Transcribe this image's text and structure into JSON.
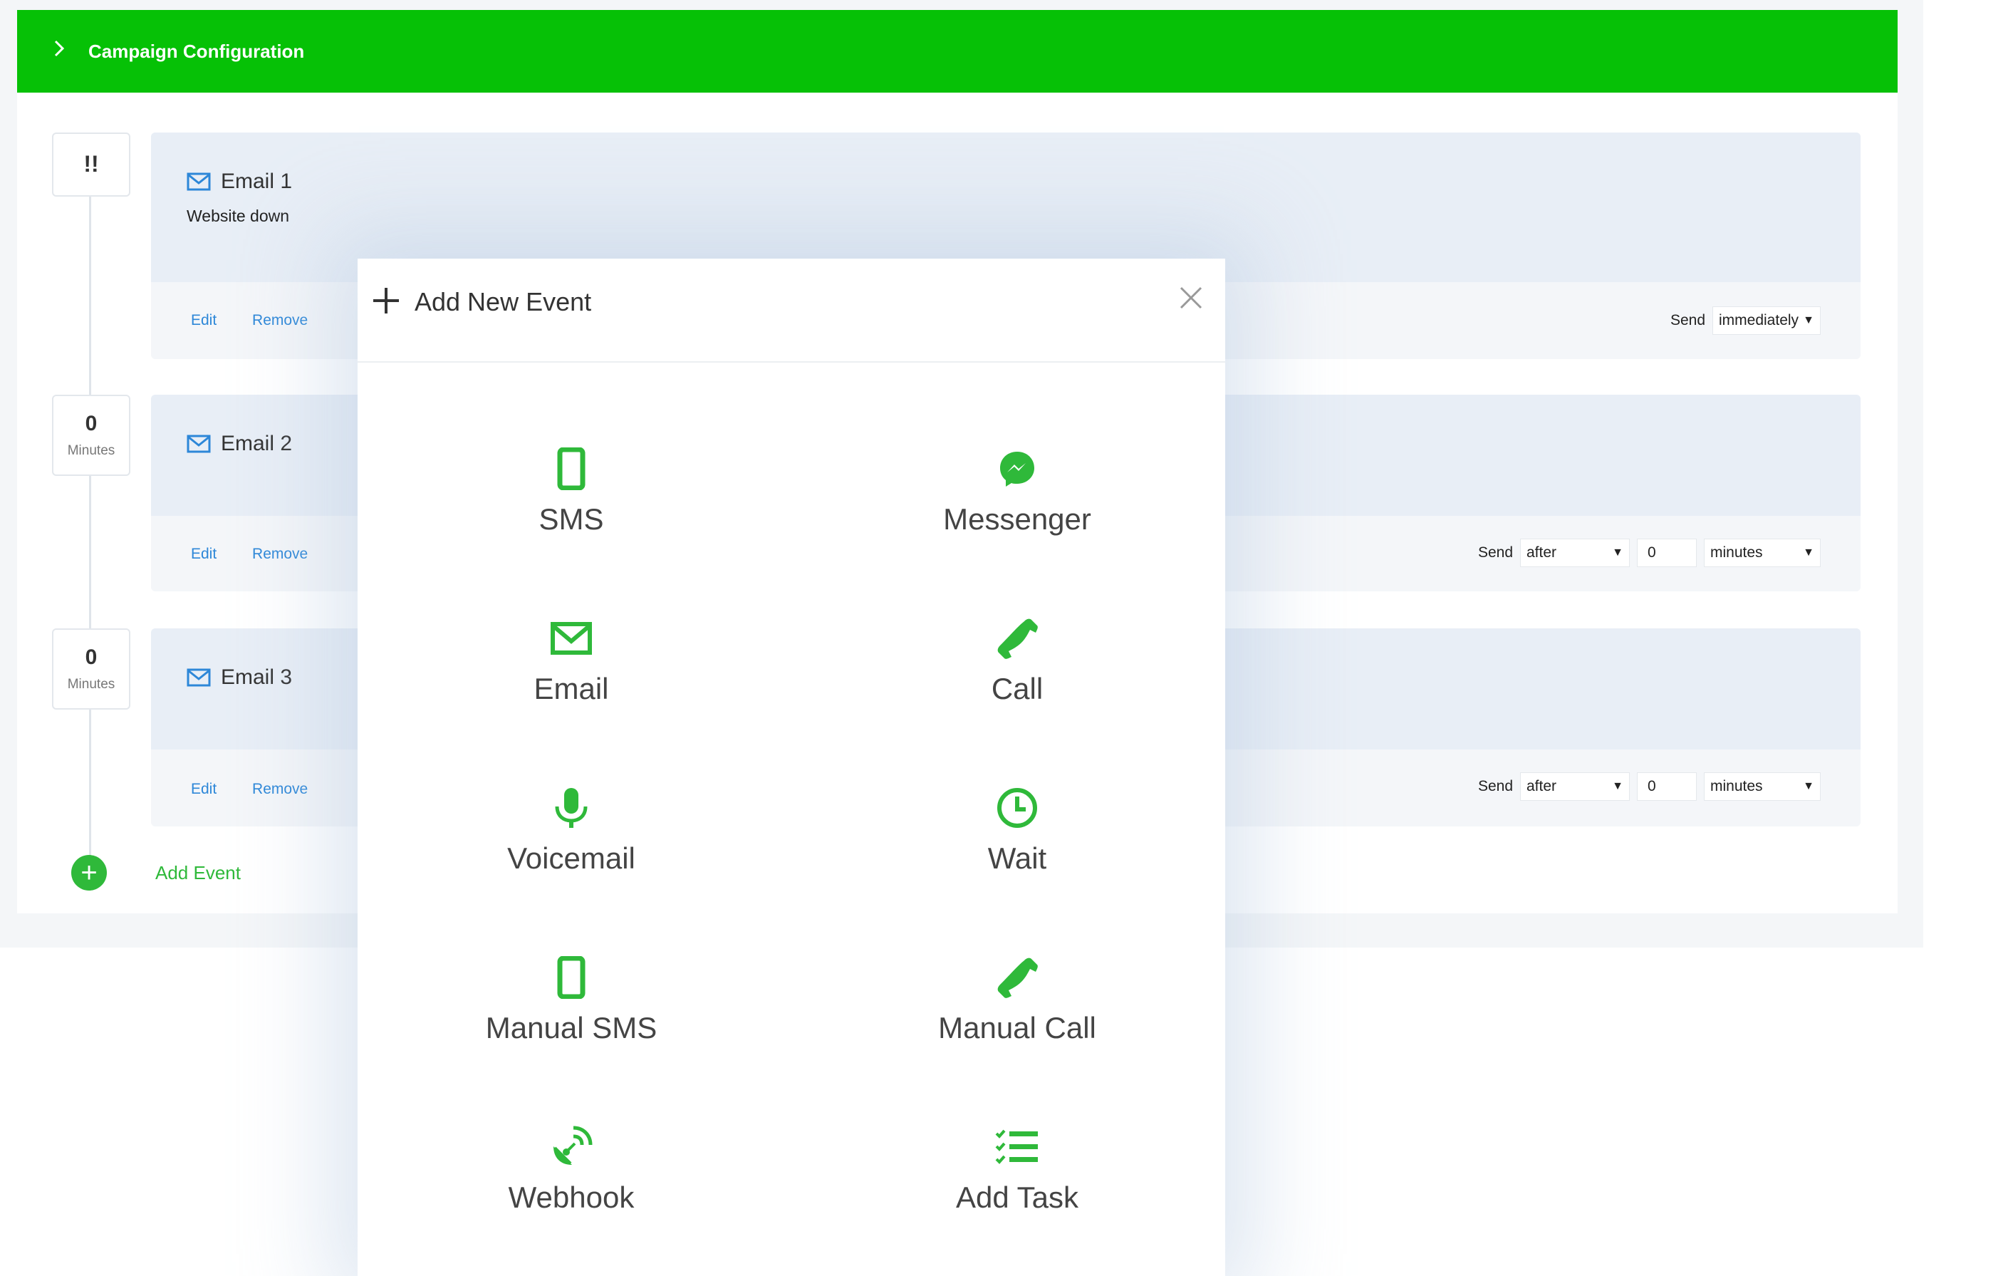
{
  "header": {
    "title": "Campaign Configuration",
    "chevron_icon": "chevron-right-icon"
  },
  "colors": {
    "brand_green": "#06c106",
    "icon_green": "#2fb93a",
    "link_blue": "#2d87d8"
  },
  "timeline": [
    {
      "value": "!!"
    },
    {
      "value": "0",
      "unit": "Minutes"
    },
    {
      "value": "0",
      "unit": "Minutes"
    }
  ],
  "events": [
    {
      "title": "Email 1",
      "subtitle": "Website down",
      "edit": "Edit",
      "remove": "Remove",
      "send_label": "Send",
      "send_when": "immediately"
    },
    {
      "title": "Email 2",
      "edit": "Edit",
      "remove": "Remove",
      "send_label": "Send",
      "send_when": "after",
      "delay": "0",
      "unit": "minutes"
    },
    {
      "title": "Email 3",
      "edit": "Edit",
      "remove": "Remove",
      "send_label": "Send",
      "send_when": "after",
      "delay": "0",
      "unit": "minutes"
    }
  ],
  "add_event": {
    "label": "Add Event"
  },
  "modal": {
    "title": "Add New Event",
    "options": [
      {
        "label": "SMS",
        "icon": "phone-device-icon"
      },
      {
        "label": "Messenger",
        "icon": "messenger-icon"
      },
      {
        "label": "Email",
        "icon": "envelope-icon"
      },
      {
        "label": "Call",
        "icon": "phone-handset-icon"
      },
      {
        "label": "Voicemail",
        "icon": "microphone-icon"
      },
      {
        "label": "Wait",
        "icon": "clock-icon"
      },
      {
        "label": "Manual SMS",
        "icon": "phone-device-icon"
      },
      {
        "label": "Manual Call",
        "icon": "phone-handset-icon"
      },
      {
        "label": "Webhook",
        "icon": "satellite-dish-icon"
      },
      {
        "label": "Add Task",
        "icon": "checklist-icon"
      }
    ]
  }
}
